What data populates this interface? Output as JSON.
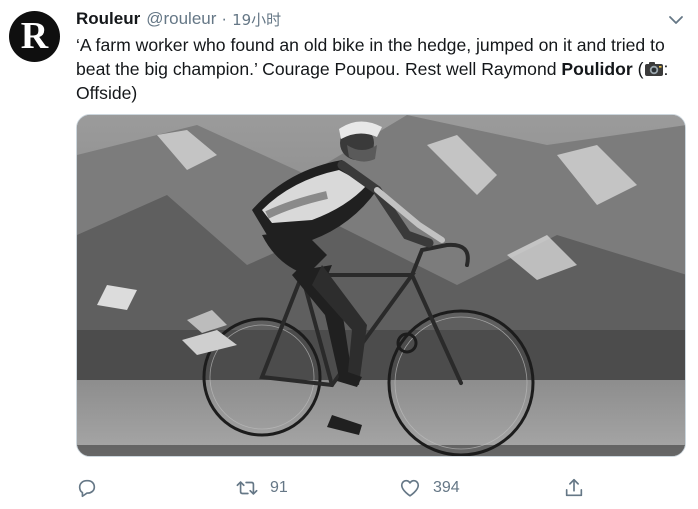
{
  "author": {
    "name": "Rouleur",
    "handle": "@rouleur",
    "avatar_letter": "R",
    "avatar_color": "#0f0f0f"
  },
  "meta": {
    "separator": "·",
    "time": "19小时"
  },
  "tweet": {
    "text_plain": "‘A farm worker who found an old bike in the hedge, jumped on it and tried to beat the big champion.’ Courage Poupou. Rest well Raymond ",
    "text_bold": "Poulidor",
    "text_tail_open": " (",
    "camera_icon": "camera-icon",
    "text_tail_close": ": Offside)"
  },
  "media": {
    "type": "photo",
    "description_icon": "photo"
  },
  "actions": {
    "reply": {
      "icon": "reply-icon",
      "count": ""
    },
    "retweet": {
      "icon": "retweet-icon",
      "count": "91"
    },
    "like": {
      "icon": "heart-icon",
      "count": "394"
    },
    "share": {
      "icon": "share-icon",
      "count": ""
    }
  },
  "colors": {
    "text_primary": "#14171a",
    "text_secondary": "#657786",
    "border": "#ccd6dd"
  }
}
